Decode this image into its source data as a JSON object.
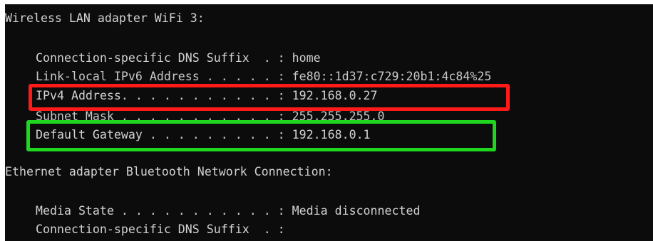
{
  "terminal": {
    "lines": [
      "Wireless LAN adapter WiFi 3:",
      "Connection-specific DNS Suffix  . : home",
      "Link-local IPv6 Address . . . . . : fe80::1d37:c729:20b1:4c84%25",
      "IPv4 Address. . . . . . . . . . . : 192.168.0.27",
      "Subnet Mask . . . . . . . . . . . : 255.255.255.0",
      "Default Gateway . . . . . . . . . : 192.168.0.1",
      "Ethernet adapter Bluetooth Network Connection:",
      "Media State . . . . . . . . . . . : Media disconnected",
      "Connection-specific DNS Suffix  . :"
    ]
  },
  "annotations": {
    "ipv4_box_color": "#ff1a1a",
    "gateway_box_color": "#1fd61f"
  }
}
